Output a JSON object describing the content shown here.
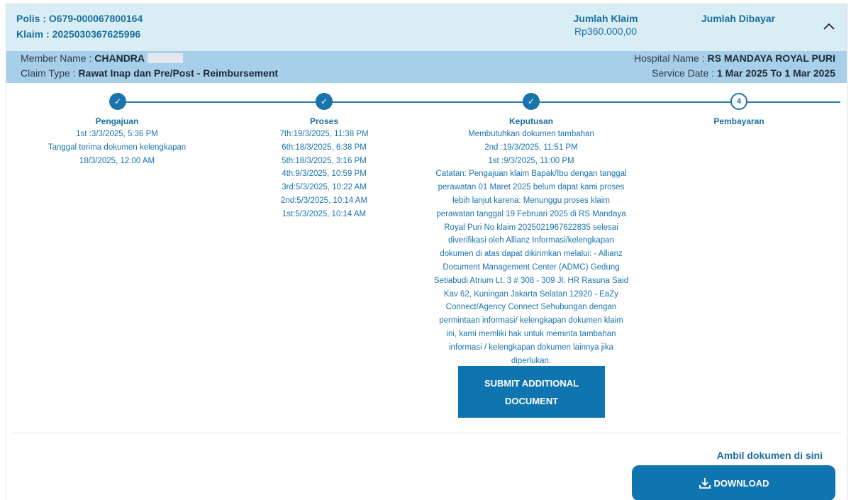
{
  "header": {
    "polis": "Polis  : O679-000067800164",
    "klaim": "Klaim : 2025030367625996",
    "jumlah_klaim_label": "Jumlah Klaim",
    "jumlah_klaim_value": "Rp360.000,00",
    "jumlah_dibayar_label": "Jumlah Dibayar",
    "collapse_icon": "chevron-up-icon"
  },
  "member": {
    "member_name_label": "Member Name : ",
    "member_name": "CHANDRA",
    "claim_type_label": "Claim Type : ",
    "claim_type": "Rawat Inap dan Pre/Post - Reimbursement",
    "hospital_label": "Hospital Name : ",
    "hospital": "RS MANDAYA ROYAL PURI",
    "service_date_label": "Service Date : ",
    "service_date": "1 Mar 2025 To 1 Mar 2025"
  },
  "steps": [
    {
      "number": "1",
      "status": "done",
      "title": "Pengajuan",
      "lines": [
        "1st :3/3/2025, 5:36 PM",
        "Tanggal terima dokumen kelengkapan",
        "18/3/2025, 12:00 AM"
      ]
    },
    {
      "number": "2",
      "status": "done",
      "title": "Proses",
      "lines": [
        "7th:19/3/2025, 11:38 PM",
        "6th:18/3/2025, 6:38 PM",
        "5th:18/3/2025, 3:16 PM",
        "4th:9/3/2025, 10:59 PM",
        "3rd:5/3/2025, 10:22 AM",
        "2nd:5/3/2025, 10:14 AM",
        "1st:5/3/2025, 10:14 AM"
      ]
    },
    {
      "number": "3",
      "status": "done",
      "title": "Keputusan",
      "lines": [
        "Membutuhkan dokumen tambahan",
        "2nd :19/3/2025, 11:51 PM",
        "1st :9/3/2025, 11:00 PM",
        "Catatan: Pengajuan klaim Bapak/Ibu dengan tanggal",
        "perawatan 01 Maret 2025 belum dapat kami proses",
        "lebih lanjut karena: Menunggu proses klaim",
        "perawatan tanggal 19 Februari 2025 di RS Mandaya",
        "Royal Puri No klaim 2025021967622835 selesai",
        "diverifikasi oleh Allianz Informasi/kelengkapan",
        "dokumen di atas dapat dikirimkan melalui: - Allianz",
        "Document Management Center (ADMC) Gedung",
        "Setiabudi Atrium Lt. 3 # 308 - 309 Jl. HR Rasuna Said",
        "Kav 62, Kuningan Jakarta Selatan 12920 - EaZy",
        "Connect/Agency Connect Sehubungan dengan",
        "permintaan informasi/ kelengkapan dokumen klaim",
        "ini, kami memliki hak untuk meminta tambahan",
        "informasi / kelengkapan dokumen lainnya jika",
        "diperlukan."
      ]
    },
    {
      "number": "4",
      "status": "pending",
      "title": "Pembayaran",
      "lines": []
    }
  ],
  "check_glyph": "✓",
  "submit_button": {
    "line1": "SUBMIT ADDITIONAL",
    "line2": "DOCUMENT"
  },
  "download": {
    "prompt": "Ambil dokumen di sini",
    "label": "DOWNLOAD",
    "icon": "download-icon"
  },
  "colors": {
    "header_bg": "#d9eef4",
    "member_bar_bg": "#a8cfe9",
    "accent": "#0f75b0",
    "text_blue": "#1a6fa0"
  }
}
